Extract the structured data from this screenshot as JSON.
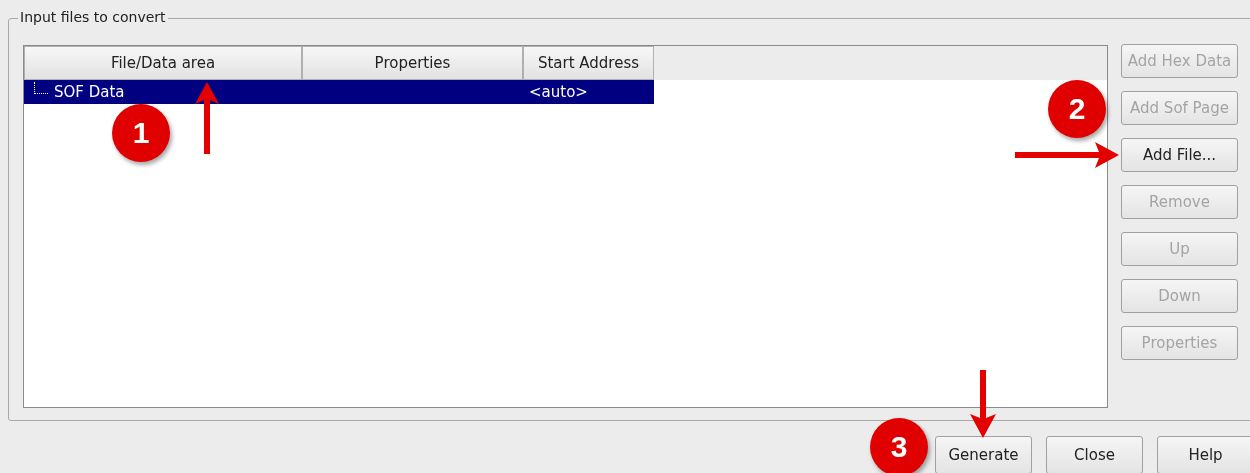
{
  "group": {
    "title": "Input files to convert"
  },
  "table": {
    "columns": [
      "File/Data area",
      "Properties",
      "Start Address"
    ],
    "rows": [
      {
        "cells": [
          "SOF Data",
          "",
          "<auto>"
        ],
        "selected": true
      }
    ]
  },
  "side_buttons": [
    {
      "label": "Add Hex Data",
      "disabled": true
    },
    {
      "label": "Add Sof Page",
      "disabled": true
    },
    {
      "label": "Add File...",
      "disabled": false
    },
    {
      "label": "Remove",
      "disabled": true
    },
    {
      "label": "Up",
      "disabled": true
    },
    {
      "label": "Down",
      "disabled": true
    },
    {
      "label": "Properties",
      "disabled": true
    }
  ],
  "bottom_buttons": [
    {
      "label": "Generate",
      "disabled": false
    },
    {
      "label": "Close",
      "disabled": false
    },
    {
      "label": "Help",
      "disabled": false
    }
  ],
  "annotations": [
    {
      "number": "1",
      "kind": "up"
    },
    {
      "number": "2",
      "kind": "right"
    },
    {
      "number": "3",
      "kind": "down"
    }
  ]
}
